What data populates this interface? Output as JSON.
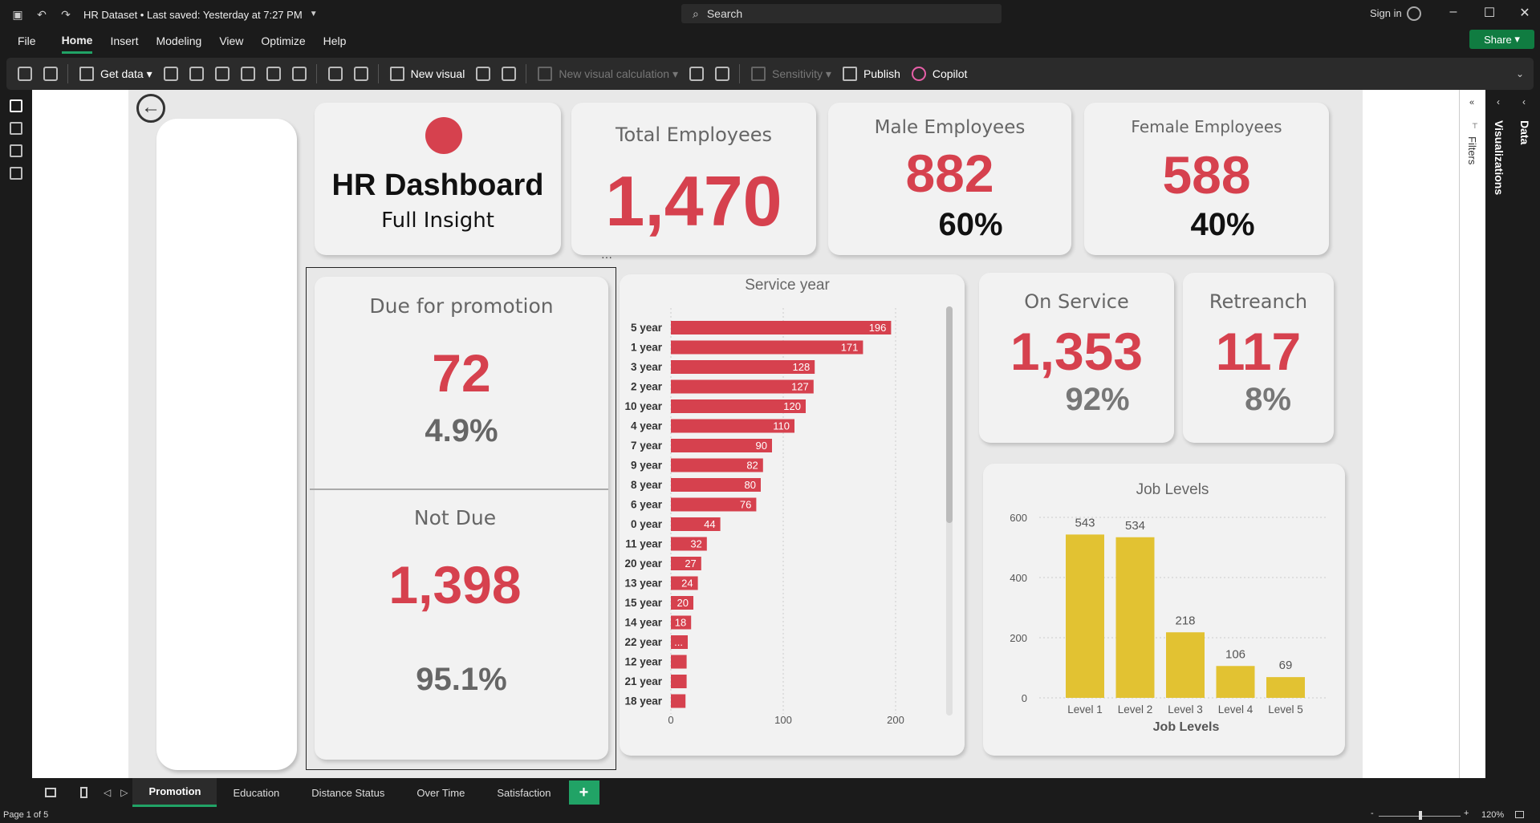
{
  "titlebar": {
    "title": "HR Dataset • Last saved: Yesterday at 7:27 PM",
    "search_placeholder": "Search",
    "signin": "Sign in"
  },
  "menu": {
    "items": [
      "File",
      "Home",
      "Insert",
      "Modeling",
      "View",
      "Optimize",
      "Help"
    ],
    "share": "Share"
  },
  "ribbon": {
    "get_data": "Get data",
    "new_visual": "New visual",
    "new_visual_calc": "New visual calculation",
    "sensitivity": "Sensitivity",
    "publish": "Publish",
    "copilot": "Copilot"
  },
  "side_panels": {
    "filters": "Filters",
    "visualizations": "Visualizations",
    "data": "Data"
  },
  "header_card": {
    "title": "HR Dashboard",
    "subtitle": "Full Insight"
  },
  "total": {
    "title": "Total Employees",
    "value": "1,470"
  },
  "male": {
    "title": "Male Employees",
    "value": "882",
    "pct": "60%"
  },
  "female": {
    "title": "Female Employees",
    "value": "588",
    "pct": "40%"
  },
  "promotion": {
    "due_title": "Due for promotion",
    "due_value": "72",
    "due_pct": "4.9%",
    "not_title": "Not Due",
    "not_value": "1,398",
    "not_pct": "95.1%"
  },
  "on_service": {
    "title": "On Service",
    "value": "1,353",
    "pct": "92%"
  },
  "retreanch": {
    "title": "Retreanch",
    "value": "117",
    "pct": "8%"
  },
  "colors": {
    "accent_red": "#d6414e",
    "bar_yellow": "#e2c232",
    "brand_green": "#21a366"
  },
  "chart_data": [
    {
      "type": "bar",
      "orientation": "horizontal",
      "title": "Service year",
      "categories": [
        "5 year",
        "1 year",
        "3 year",
        "2 year",
        "10 year",
        "4 year",
        "7 year",
        "9 year",
        "8 year",
        "6 year",
        "0 year",
        "11 year",
        "20 year",
        "13 year",
        "15 year",
        "14 year",
        "22 year",
        "12 year",
        "21 year",
        "18 year"
      ],
      "values": [
        196,
        171,
        128,
        127,
        120,
        110,
        90,
        82,
        80,
        76,
        44,
        32,
        27,
        24,
        20,
        18,
        15,
        14,
        14,
        13
      ],
      "labels": [
        "196",
        "171",
        "128",
        "127",
        "120",
        "110",
        "90",
        "82",
        "80",
        "76",
        "44",
        "32",
        "27",
        "24",
        "20",
        "18",
        "...",
        "",
        "",
        ""
      ],
      "xticks": [
        0,
        100,
        200
      ],
      "xlim": [
        0,
        220
      ],
      "grid": true
    },
    {
      "type": "bar",
      "title": "Job Levels",
      "xlabel": "Job Levels",
      "categories": [
        "Level 1",
        "Level 2",
        "Level 3",
        "Level 4",
        "Level 5"
      ],
      "values": [
        543,
        534,
        218,
        106,
        69
      ],
      "yticks": [
        0,
        200,
        400,
        600
      ],
      "ylim": [
        0,
        600
      ],
      "grid": true
    }
  ],
  "tabs": {
    "items": [
      "Promotion",
      "Education",
      "Distance Status",
      "Over Time",
      "Satisfaction"
    ],
    "active": "Promotion"
  },
  "status": {
    "page": "Page 1 of 5",
    "zoom": "120%"
  }
}
